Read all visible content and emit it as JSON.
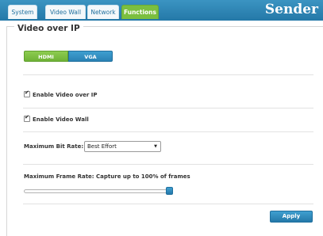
{
  "nav": {
    "tabs": [
      {
        "label": "System"
      },
      {
        "label": "Video Wall"
      },
      {
        "label": "Network"
      },
      {
        "label": "Functions",
        "active": true
      }
    ],
    "brand": "Sender"
  },
  "section": {
    "title": "Video over IP",
    "source_tabs": [
      {
        "label": "HDMI",
        "selected": true
      },
      {
        "label": "VGA",
        "selected": false
      }
    ]
  },
  "options": {
    "enable_video_over_ip": {
      "label": "Enable Video over IP",
      "checked": true
    },
    "enable_video_wall": {
      "label": "Enable Video Wall",
      "checked": true
    }
  },
  "bitrate": {
    "label": "Maximum Bit Rate:",
    "value": "Best Effort"
  },
  "framerate": {
    "label": "Maximum Frame Rate: Capture up to 100% of frames",
    "percent": 100
  },
  "actions": {
    "apply_label": "Apply"
  },
  "colors": {
    "header": "#2a84b4",
    "active_tab": "#7bbf3f",
    "accent": "#2a82b5"
  }
}
